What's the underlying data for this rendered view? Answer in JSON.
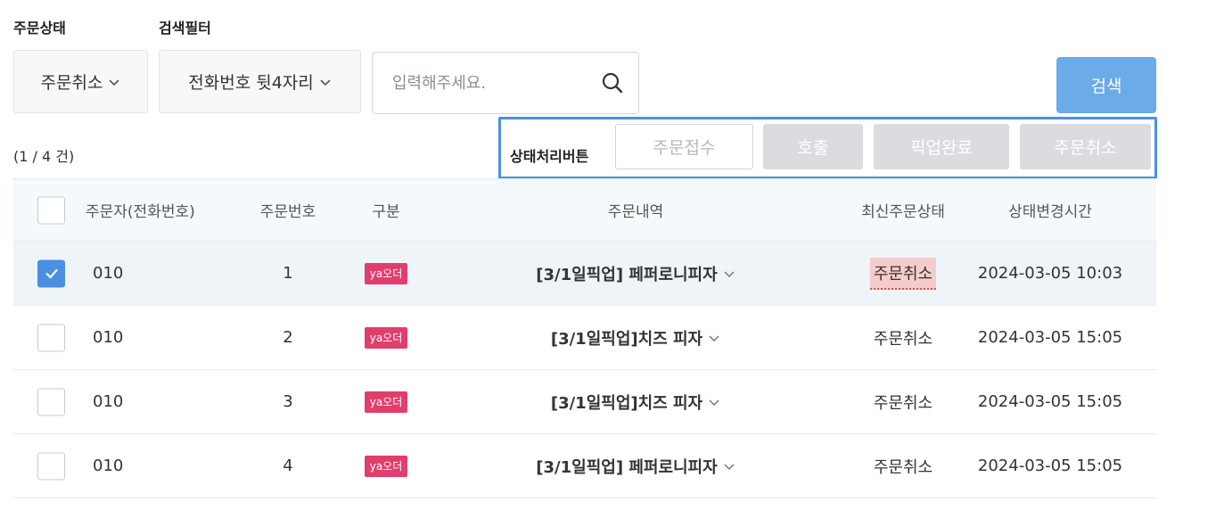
{
  "filters": {
    "order_status_label": "주문상태",
    "search_filter_label": "검색필터",
    "order_status_value": "주문취소",
    "search_filter_value": "전화번호 뒷4자리",
    "search_placeholder": "입력해주세요.",
    "search_button": "검색"
  },
  "result_count": "(1 / 4 건)",
  "status_actions": {
    "label": "상태처리버튼",
    "buttons": [
      "주문접수",
      "호출",
      "픽업완료",
      "주문취소"
    ]
  },
  "table": {
    "headers": [
      "주문자(전화번호)",
      "주문번호",
      "구분",
      "주문내역",
      "최신주문상태",
      "상태변경시간"
    ],
    "rows": [
      {
        "checked": true,
        "phone": "010",
        "order_no": "1",
        "type": "ya오더",
        "detail": "[3/1일픽업] 페퍼로니피자",
        "status": "주문취소",
        "changed_at": "2024-03-05 10:03"
      },
      {
        "checked": false,
        "phone": "010",
        "order_no": "2",
        "type": "ya오더",
        "detail": "[3/1일픽업]치즈 피자",
        "status": "주문취소",
        "changed_at": "2024-03-05 15:05"
      },
      {
        "checked": false,
        "phone": "010",
        "order_no": "3",
        "type": "ya오더",
        "detail": "[3/1일픽업]치즈 피자",
        "status": "주문취소",
        "changed_at": "2024-03-05 15:05"
      },
      {
        "checked": false,
        "phone": "010",
        "order_no": "4",
        "type": "ya오더",
        "detail": "[3/1일픽업] 페퍼로니피자",
        "status": "주문취소",
        "changed_at": "2024-03-05 15:05"
      }
    ]
  },
  "colors": {
    "accent": "#4a90e2",
    "search_button": "#6aabe8",
    "tag": "#e03e6d",
    "status_highlight": "#f5cbcb"
  }
}
